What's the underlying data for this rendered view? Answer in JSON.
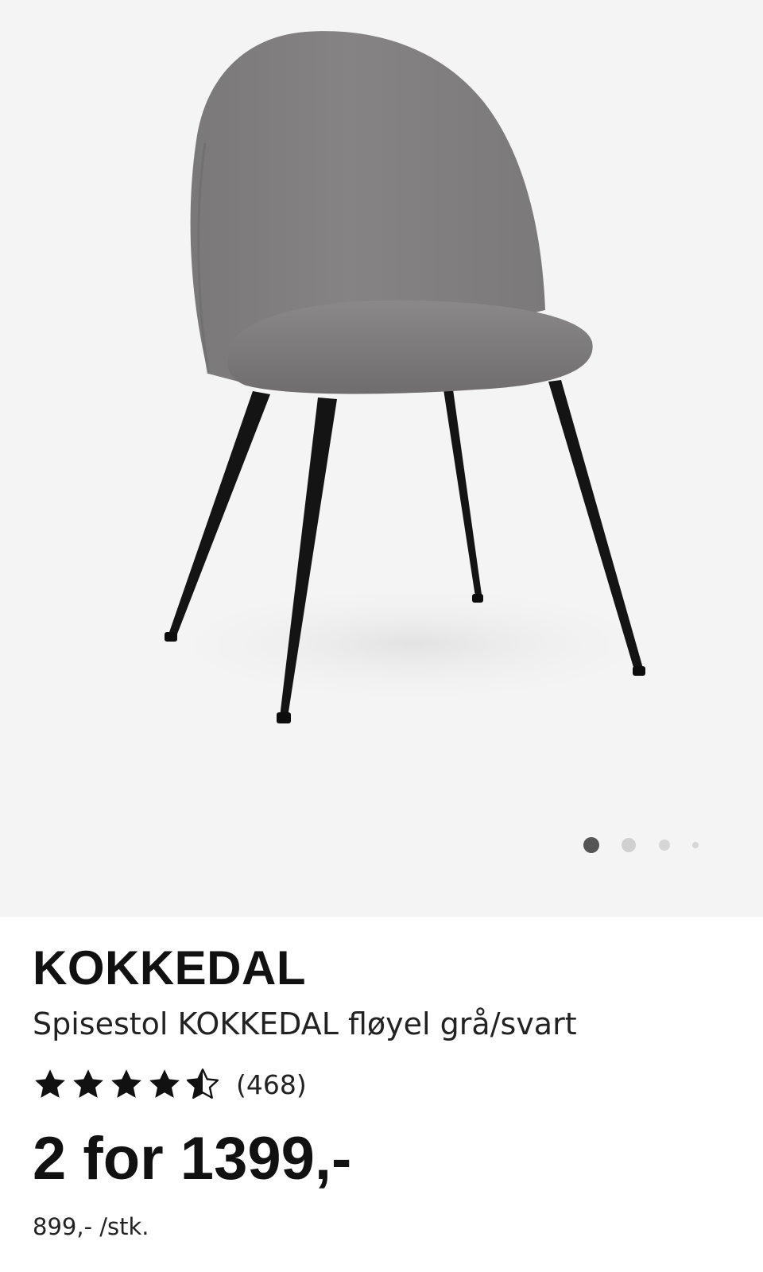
{
  "gallery": {
    "image_alt": "Spisestol KOKKEDAL fløyel grå/svart",
    "slide_count": 4,
    "active_slide": 1,
    "background_color": "#f4f4f4"
  },
  "product": {
    "brand": "KOKKEDAL",
    "description": "Spisestol KOKKEDAL fløyel grå/svart",
    "rating": 4.5,
    "rating_max": 5,
    "review_count_text": "(468)",
    "price_text": "2 for 1399,-",
    "unit_price_text": "899,- /stk."
  },
  "icons": {
    "star_full": "star-filled-icon",
    "star_half": "star-half-icon"
  },
  "colors": {
    "text": "#111111",
    "chair_fabric": "#7d7b7b",
    "chair_legs": "#111111",
    "dot_active": "#555555",
    "dot_inactive": "#d0d0d0"
  }
}
